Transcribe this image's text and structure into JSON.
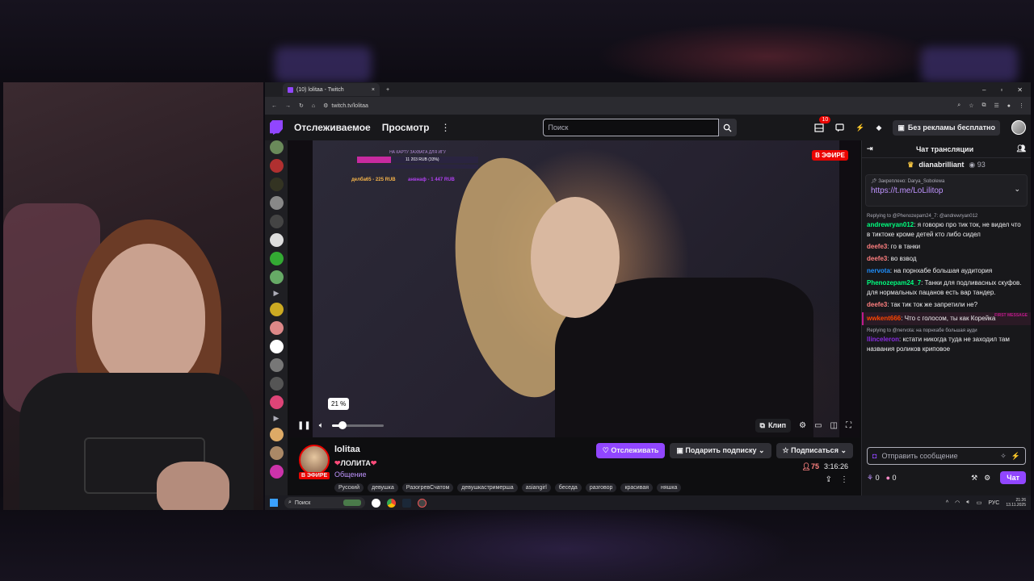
{
  "browser": {
    "tab_title": "(10) lolitaa - Twitch",
    "tab_close": "×",
    "new_tab": "+",
    "url": "twitch.tv/lolitaa"
  },
  "twitch_nav": {
    "following": "Отслеживаемое",
    "browse": "Просмотр",
    "search_placeholder": "Поиск",
    "notif_count": "10",
    "turbo_label": "Без рекламы бесплатно"
  },
  "player": {
    "live_label": "В ЭФИРЕ",
    "volume_tooltip": "21 %",
    "volume_level": 0.21,
    "clip_label": "Клип",
    "overlay_top": "НА КАРТУ ЗАХВАТА ДЛЯ ИГУ",
    "overlay_bar_text": "11 203 RUB (33%)",
    "overlay_money_left": "делба65 - 225 RUB",
    "overlay_money_right": "aнвнаф - 1 447 RUB"
  },
  "channel": {
    "name": "lolitaa",
    "title": "ЛОЛИТА",
    "category": "Общение",
    "live_badge": "В ЭФИРЕ",
    "viewers": "75",
    "uptime": "3:16:26",
    "follow_label": "Отслеживать",
    "gift_label": "Подарить подписку",
    "subscribe_label": "Подписаться",
    "tags": [
      "Русский",
      "девушка",
      "РазогревСчатом",
      "девушкастримерша",
      "asiangirl",
      "беседа",
      "разговор",
      "красивая",
      "няшка"
    ]
  },
  "chat": {
    "title": "Чат трансляции",
    "leader_name": "dianabrilliant",
    "leader_count": "93",
    "pinned_by": "Закреплено: Darya_Sobolewa",
    "pinned_link": "https://t.me/LoLilitop",
    "messages": [
      {
        "reply": "Replying to @Phenozepam24_7: @andrewryan012",
        "user": "andrewryan012",
        "text": ": я говорю про тик ток, не видел что в тиктоке кроме детей кто либо сидел",
        "cls": "u1"
      },
      {
        "reply": "",
        "user": "deefe3",
        "text": ": го в танки",
        "cls": "u2"
      },
      {
        "reply": "",
        "user": "deefe3",
        "text": ": во взвод",
        "cls": "u2"
      },
      {
        "reply": "",
        "user": "nervota",
        "text": ": на порнхабе большая аудитория",
        "cls": "u3"
      },
      {
        "reply": "",
        "user": "Phenozepam24_7",
        "text": ": Танки для подливасных скуфов. для нормальных пацанов есть вар тандер.",
        "cls": "u4"
      },
      {
        "reply": "",
        "user": "deefe3",
        "text": ": так тик ток же запретили не?",
        "cls": "u2"
      }
    ],
    "first_msg": {
      "tag": "FIRST MESSAGE",
      "user": "wwkent666",
      "text": ": Что с голосом, ты как Корейка"
    },
    "last_msg": {
      "reply": "Replying to @nervota: на порнхабе большая ауди",
      "user": "llinceleron",
      "text": ": кстати никогда туда не заходил там названия роликов криповое"
    },
    "input_placeholder": "Отправить сообщение",
    "points_a": "0",
    "points_b": "0",
    "chat_button": "Чат"
  },
  "taskbar": {
    "search": "Поиск",
    "lang": "РУС",
    "time": "21:26",
    "date": "13.11.2025"
  }
}
